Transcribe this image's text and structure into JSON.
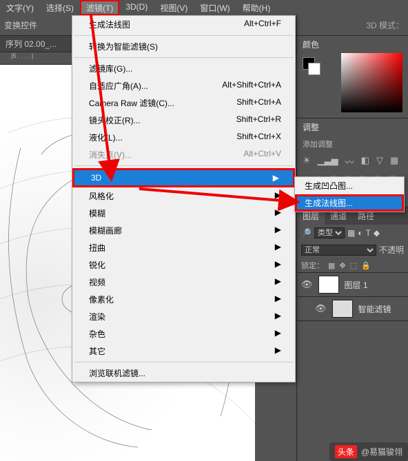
{
  "menubar": {
    "items": [
      "文字(Y)",
      "选择(S)",
      "滤镜(T)",
      "3D(D)",
      "视图(V)",
      "窗口(W)",
      "帮助(H)"
    ]
  },
  "toolbar": {
    "label": "变换控件",
    "mode_label": "3D 模式："
  },
  "tab": {
    "name": "序列 02.00_..."
  },
  "ruler": {
    "marks": "|5 . . . . |"
  },
  "dropdown": {
    "gen_normal": "生成法线图",
    "gen_normal_shortcut": "Alt+Ctrl+F",
    "to_smart": "转换为智能滤镜(S)",
    "filter_gallery": "滤镜库(G)...",
    "adaptive_wide": "自适应广角(A)...",
    "adaptive_wide_sc": "Alt+Shift+Ctrl+A",
    "camera_raw": "Camera Raw 滤镜(C)...",
    "camera_raw_sc": "Shift+Ctrl+A",
    "lens": "镜头校正(R)...",
    "lens_sc": "Shift+Ctrl+R",
    "liquify": "液化(L)...",
    "liquify_sc": "Shift+Ctrl+X",
    "vanish": "消失点(V)...",
    "vanish_sc": "Alt+Ctrl+V",
    "3d": "3D",
    "stylize": "风格化",
    "blur": "模糊",
    "blur_gallery": "模糊画廊",
    "distort": "扭曲",
    "sharpen": "锐化",
    "video": "视频",
    "pixelate": "像素化",
    "render": "渲染",
    "noise": "杂色",
    "other": "其它",
    "browse": "浏览联机滤镜..."
  },
  "submenu": {
    "bump": "生成凹凸图...",
    "normal": "生成法线图..."
  },
  "panels": {
    "color": "颜色",
    "adjust": "调整",
    "adjust_add": "添加调整",
    "layers": "图层",
    "channels": "通道",
    "paths": "路径",
    "kind": "类型",
    "normal": "正常",
    "opacity": "不透明",
    "lock": "锁定：",
    "layer1": "图层 1",
    "smart": "智能滤镜"
  },
  "footer": {
    "brand": "头条",
    "author": "@易猫骏翎"
  }
}
